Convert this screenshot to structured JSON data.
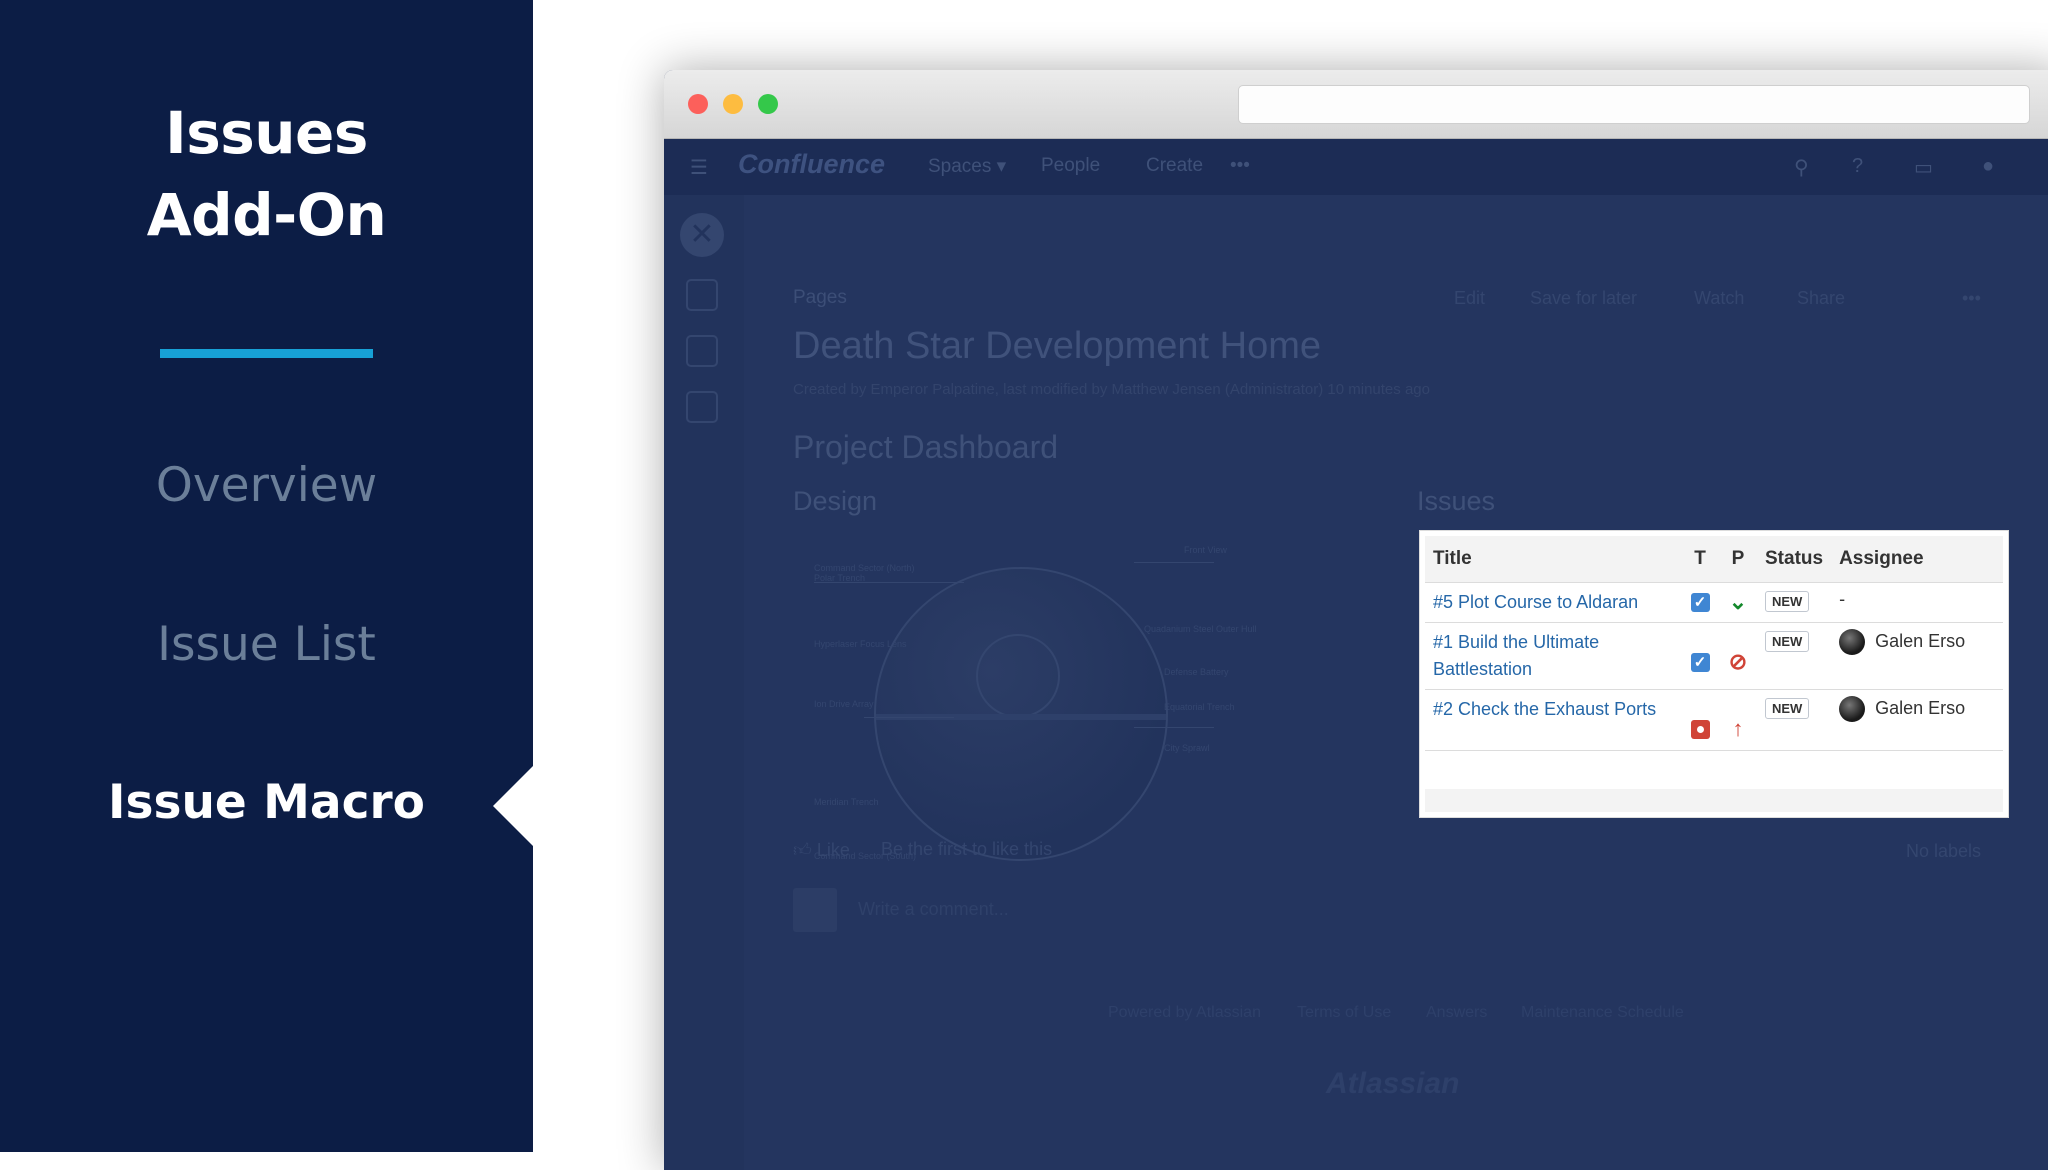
{
  "sidebar": {
    "title_line1": "Issues",
    "title_line2": "Add-On",
    "items": [
      {
        "label": "Overview",
        "active": false
      },
      {
        "label": "Issue List",
        "active": false
      },
      {
        "label": "Issue Macro",
        "active": true
      }
    ],
    "accent_color": "#17a1d6",
    "background_color": "#0c1d45"
  },
  "browser": {
    "traffic_lights": [
      "#fc605b",
      "#fdbc40",
      "#34c84a"
    ],
    "url": ""
  },
  "confluence": {
    "nav": {
      "logo": "Confluence",
      "items": [
        "Spaces ▾",
        "People",
        "Create",
        "•••"
      ],
      "icons": [
        "menu-icon",
        "search-icon",
        "help-icon",
        "notifications-icon",
        "user-avatar"
      ]
    },
    "breadcrumb": "Pages",
    "page_actions": [
      "Edit",
      "Save for later",
      "Watch",
      "Share",
      "•••"
    ],
    "page_title": "Death Star Development Home",
    "byline": "Created by Emperor Palpatine, last modified by Matthew Jensen (Administrator) 10 minutes ago",
    "section_title": "Project Dashboard",
    "design_heading": "Design",
    "issues_heading": "Issues",
    "like_label": "Like",
    "like_text": "Be the first to like this",
    "no_labels": "No labels",
    "comment_placeholder": "Write a comment...",
    "footer_links": [
      "Powered by Atlassian",
      "Terms of Use",
      "Answers",
      "Maintenance Schedule"
    ],
    "footer_logo": "Atlassian",
    "diagram_labels": [
      "Front View",
      "Command Sector (North)",
      "Polar Trench",
      "Hyperlaser Focus Lens",
      "Ion Drive Array",
      "Quadanium Steel Outer Hull",
      "Defense Battery",
      "Equatorial Trench",
      "City Sprawl",
      "Meridian Trench",
      "Command Sector (South)"
    ]
  },
  "issues_macro": {
    "columns": [
      "Title",
      "T",
      "P",
      "Status",
      "Assignee"
    ],
    "rows": [
      {
        "title": "#5 Plot Course to Aldaran",
        "type": "task",
        "priority": "lowest",
        "priority_glyph": "⌄",
        "priority_color": "#14892c",
        "status": "NEW",
        "assignee": "-",
        "has_avatar": false
      },
      {
        "title": "#1 Build the Ultimate Battlestation",
        "type": "task",
        "priority": "blocker",
        "priority_glyph": "⊘",
        "priority_color": "#d04437",
        "status": "NEW",
        "assignee": "Galen Erso",
        "has_avatar": true
      },
      {
        "title": "#2 Check the Exhaust Ports",
        "type": "bug",
        "priority": "major",
        "priority_glyph": "↑",
        "priority_color": "#d04437",
        "status": "NEW",
        "assignee": "Galen Erso",
        "has_avatar": true
      }
    ]
  }
}
